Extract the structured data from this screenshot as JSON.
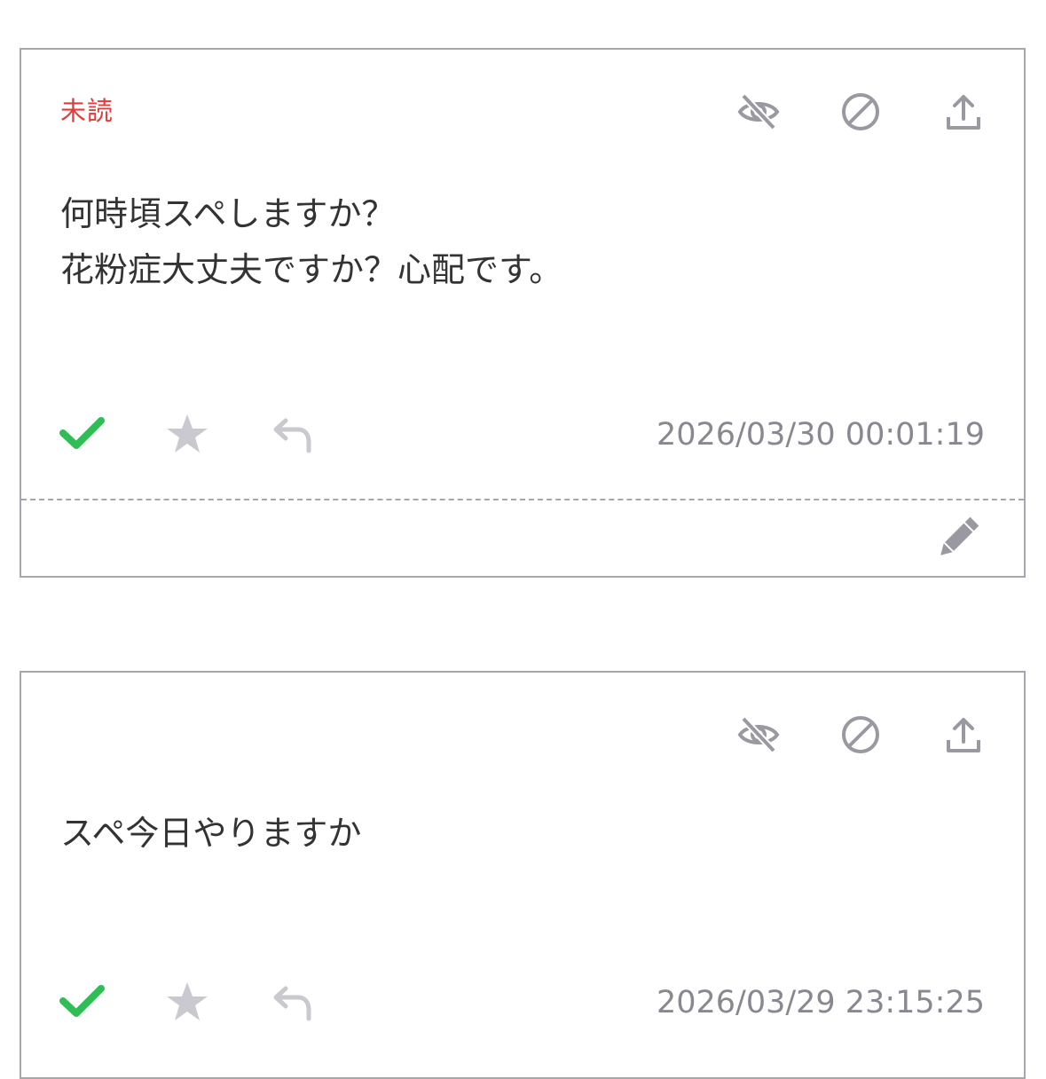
{
  "colors": {
    "border": "#a7a6ae",
    "unread": "#e03c3c",
    "check": "#2fbd55",
    "inactive_icon": "#c9c9cf",
    "icon": "#9a99a1",
    "timestamp": "#888890"
  },
  "messages": [
    {
      "status": "未読",
      "text": "何時頃スペしますか？\n花粉症大丈夫ですか？心配です。",
      "timestamp": "2026/03/30 00:01:19",
      "icons": [
        "hide-icon",
        "block-icon",
        "share-icon",
        "check-icon",
        "star-icon",
        "reply-icon",
        "edit-icon"
      ]
    },
    {
      "status": "",
      "text": "スペ今日やりますか",
      "timestamp": "2026/03/29 23:15:25",
      "icons": [
        "hide-icon",
        "block-icon",
        "share-icon",
        "check-icon",
        "star-icon",
        "reply-icon"
      ]
    }
  ]
}
